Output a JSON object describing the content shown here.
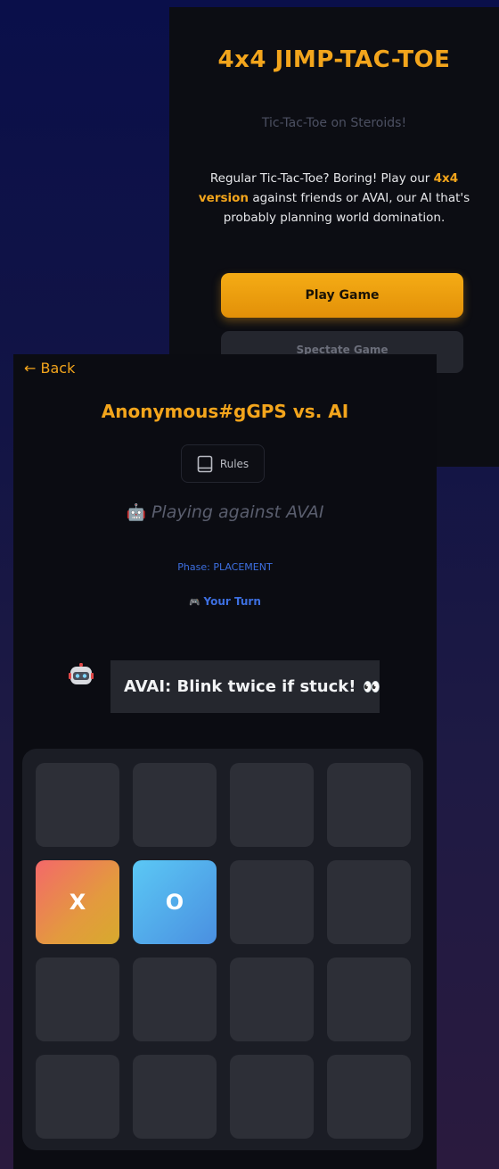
{
  "home": {
    "title": "4x4 JIMP-TAC-TOE",
    "tagline": "Tic-Tac-Toe on Steroids!",
    "description_prefix": "Regular Tic-Tac-Toe? Boring! Play our ",
    "description_highlight": "4x4 version",
    "description_suffix": " against friends or AVAI, our AI that's probably planning world domination.",
    "play_button": "Play Game",
    "spectate_button": "Spectate Game"
  },
  "game": {
    "back_label": "← Back",
    "title": "Anonymous#gGPS vs. AI",
    "rules_label": "Rules",
    "opponent_emoji": "🤖",
    "opponent_text": "Playing against AVAI",
    "phase": "Phase: PLACEMENT",
    "turn_emoji": "🎮",
    "turn_text": "Your Turn",
    "bot_message": "AVAI: Blink twice if stuck!",
    "bot_message_emoji": "👀",
    "board": [
      [
        "",
        "",
        "",
        ""
      ],
      [
        "X",
        "O",
        "",
        ""
      ],
      [
        "",
        "",
        "",
        ""
      ],
      [
        "",
        "",
        "",
        ""
      ]
    ]
  },
  "colors": {
    "accent": "#f3a51c",
    "x_piece": "#f4686a",
    "o_piece": "#5bc8f5",
    "status_blue": "#3d6fe0"
  }
}
